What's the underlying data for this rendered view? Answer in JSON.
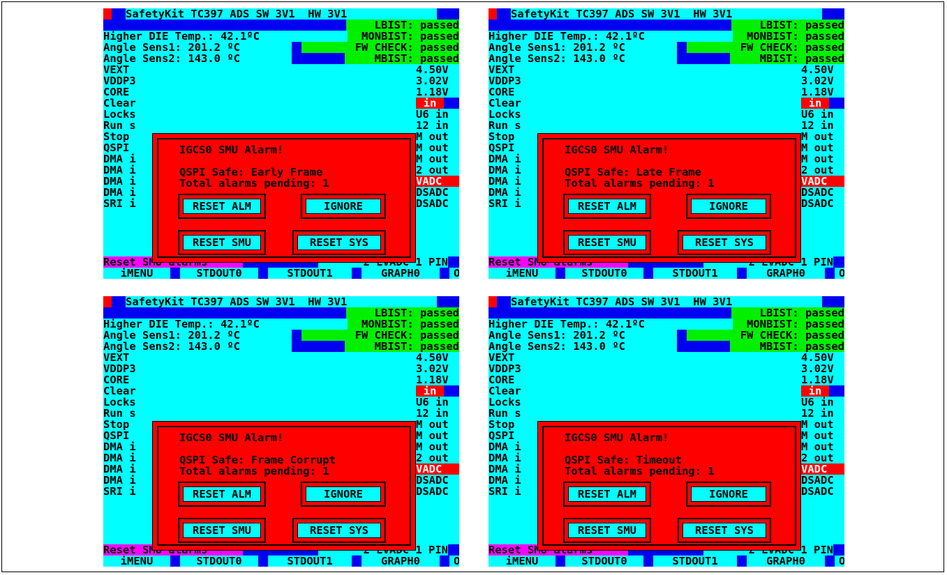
{
  "header": {
    "title": "SafetyKit TC397 ADS SW 3V1  HW 3V1"
  },
  "status": {
    "lbist": "LBIST: passed",
    "die_temp": "Higher DIE Temp.: 42.1ºC",
    "monbist": "MONBIST: passed",
    "angle1": "Angle Sens1: 201.2 ºC",
    "fw_check": "FW CHECK: passed",
    "angle2": "Angle Sens2: 143.0 ºC",
    "mbist": "MBIST: passed"
  },
  "left_list": [
    "VEXT",
    "VDDP3",
    "CORE",
    "Clear",
    "Locks",
    "Run s",
    "Stop",
    "QSPI",
    "DMA i",
    "DMA i",
    "DMA i",
    "DMA i",
    "SRI i"
  ],
  "right_list": [
    "4.50V",
    "3.02V",
    "1.18V",
    "in",
    "U6 in",
    "12 in",
    "M out",
    "M out",
    "M out",
    "2 out",
    "VADC",
    "DSADC",
    "DSADC"
  ],
  "bottom_status": {
    "left": "Reset SMU alarms",
    "right": "2 EVADC 1 PIN"
  },
  "menu": [
    "iMENU",
    "STDOUT0",
    "STDOUT1",
    "GRAPH0",
    "OFF"
  ],
  "dialog": {
    "title": "IGCS0 SMU Alarm!",
    "pending": "Total alarms pending: 1",
    "buttons": {
      "reset_alm": "RESET ALM",
      "ignore": "IGNORE",
      "reset_smu": "RESET SMU",
      "reset_sys": "RESET SYS"
    }
  },
  "screens": [
    {
      "message": "QSPI Safe: Early Frame"
    },
    {
      "message": "QSPI Safe: Late Frame"
    },
    {
      "message": "QSPI Safe: Frame Corrupt"
    },
    {
      "message": "QSPI Safe: Timeout"
    }
  ],
  "colors": {
    "cyan": "#00ffff",
    "blue": "#0000f0",
    "green": "#00f000",
    "red": "#ff0000",
    "magenta": "#ff00ff"
  }
}
